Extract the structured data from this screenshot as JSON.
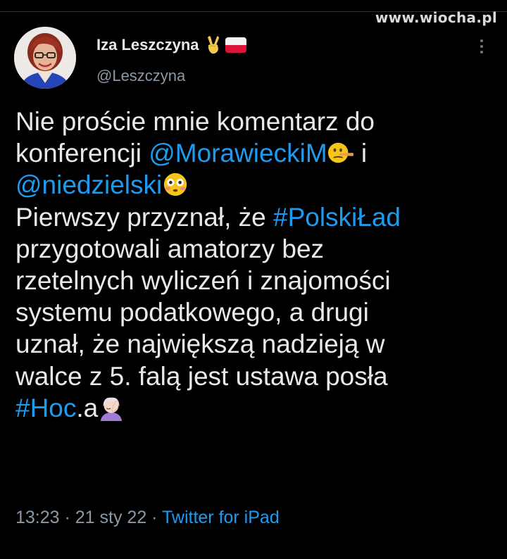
{
  "watermark": "www.wiocha.pl",
  "author": {
    "name": "Iza Leszczyna",
    "handle": "@Leszczyna",
    "name_emojis": [
      "victory-hand",
      "poland-flag"
    ]
  },
  "tweet": {
    "lines": [
      [
        {
          "t": "Nie proście mnie komentarz do",
          "k": "text"
        }
      ],
      [
        {
          "t": "konferencji ",
          "k": "text"
        },
        {
          "t": "@MorawieckiM",
          "k": "link"
        },
        {
          "t": "",
          "k": "emoji",
          "e": "lying-face"
        },
        {
          "t": " i",
          "k": "text"
        }
      ],
      [
        {
          "t": "@niedzielski",
          "k": "link"
        },
        {
          "t": "",
          "k": "emoji",
          "e": "flushed-face"
        }
      ],
      [
        {
          "t": "Pierwszy przyznał, że ",
          "k": "text"
        },
        {
          "t": "#PolskiŁad",
          "k": "link"
        }
      ],
      [
        {
          "t": "przygotowali amatorzy bez",
          "k": "text"
        }
      ],
      [
        {
          "t": "rzetelnych wyliczeń i znajomości",
          "k": "text"
        }
      ],
      [
        {
          "t": "systemu podatkowego, a drugi",
          "k": "text"
        }
      ],
      [
        {
          "t": "uznał, że największą nadzieją w",
          "k": "text"
        }
      ],
      [
        {
          "t": "walce z 5. falą jest ustawa posła",
          "k": "text"
        }
      ],
      [
        {
          "t": "#Hoc",
          "k": "link"
        },
        {
          "t": ".a",
          "k": "text"
        },
        {
          "t": "",
          "k": "emoji",
          "e": "facepalm"
        }
      ]
    ]
  },
  "meta": {
    "time": "13:23",
    "sep1": " · ",
    "date": "21 sty 22",
    "sep2": " · ",
    "source": "Twitter for iPad"
  },
  "colors": {
    "background": "#000000",
    "text": "#e7e9ea",
    "link": "#1d9bf0",
    "secondary": "#8b98a5"
  }
}
